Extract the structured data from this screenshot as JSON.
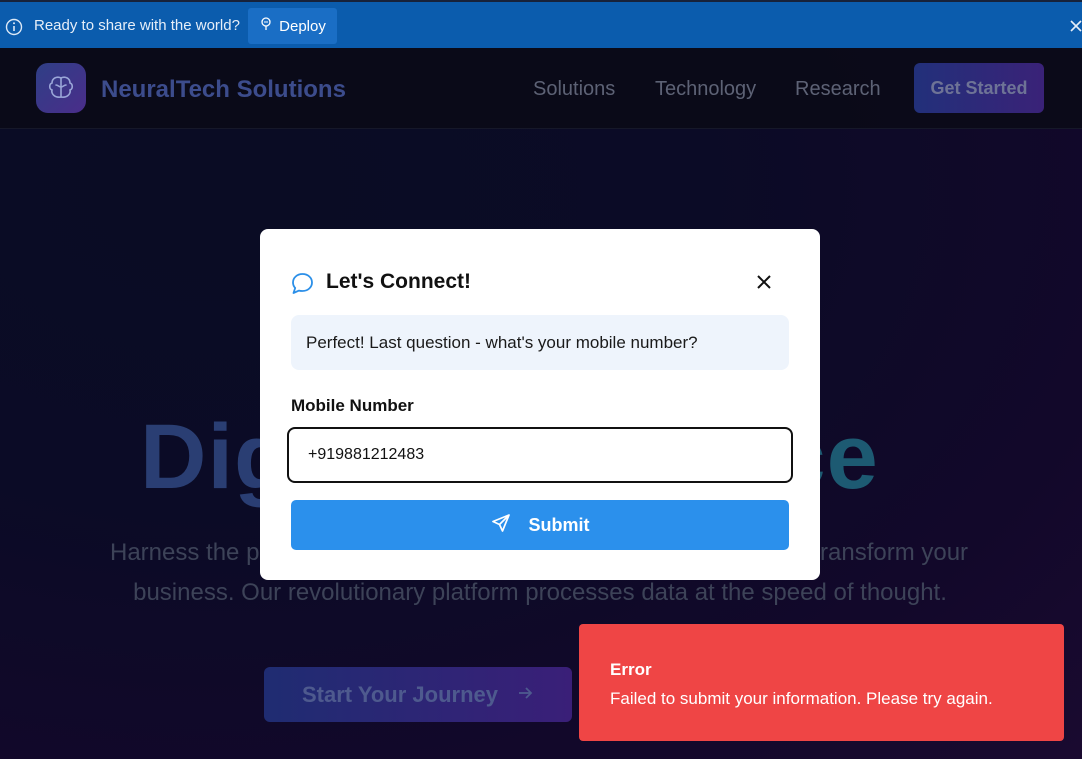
{
  "banner": {
    "text": "Ready to share with the world?",
    "deploy_label": "Deploy"
  },
  "site": {
    "brand": "NeuralTech Solutions",
    "nav": [
      "Solutions",
      "Technology",
      "Research"
    ],
    "cta": "Get Started",
    "hero_title_start": "Dig",
    "hero_title_end": "nce",
    "hero_sub_left": "Harness the p",
    "hero_sub_right": "ransform your",
    "hero_sub_line2": "business. Our revolutionary platform processes data at the speed of thought.",
    "hero_cta": "Start Your Journey"
  },
  "modal": {
    "title": "Let's Connect!",
    "prompt": "Perfect! Last question - what's your mobile number?",
    "field_label": "Mobile Number",
    "mobile_value": "+919881212483",
    "submit_label": "Submit"
  },
  "toast": {
    "title": "Error",
    "message": "Failed to submit your information. Please try again."
  },
  "colors": {
    "banner": "#0b5cad",
    "submit": "#2b90ec",
    "toast": "#ef4545"
  }
}
